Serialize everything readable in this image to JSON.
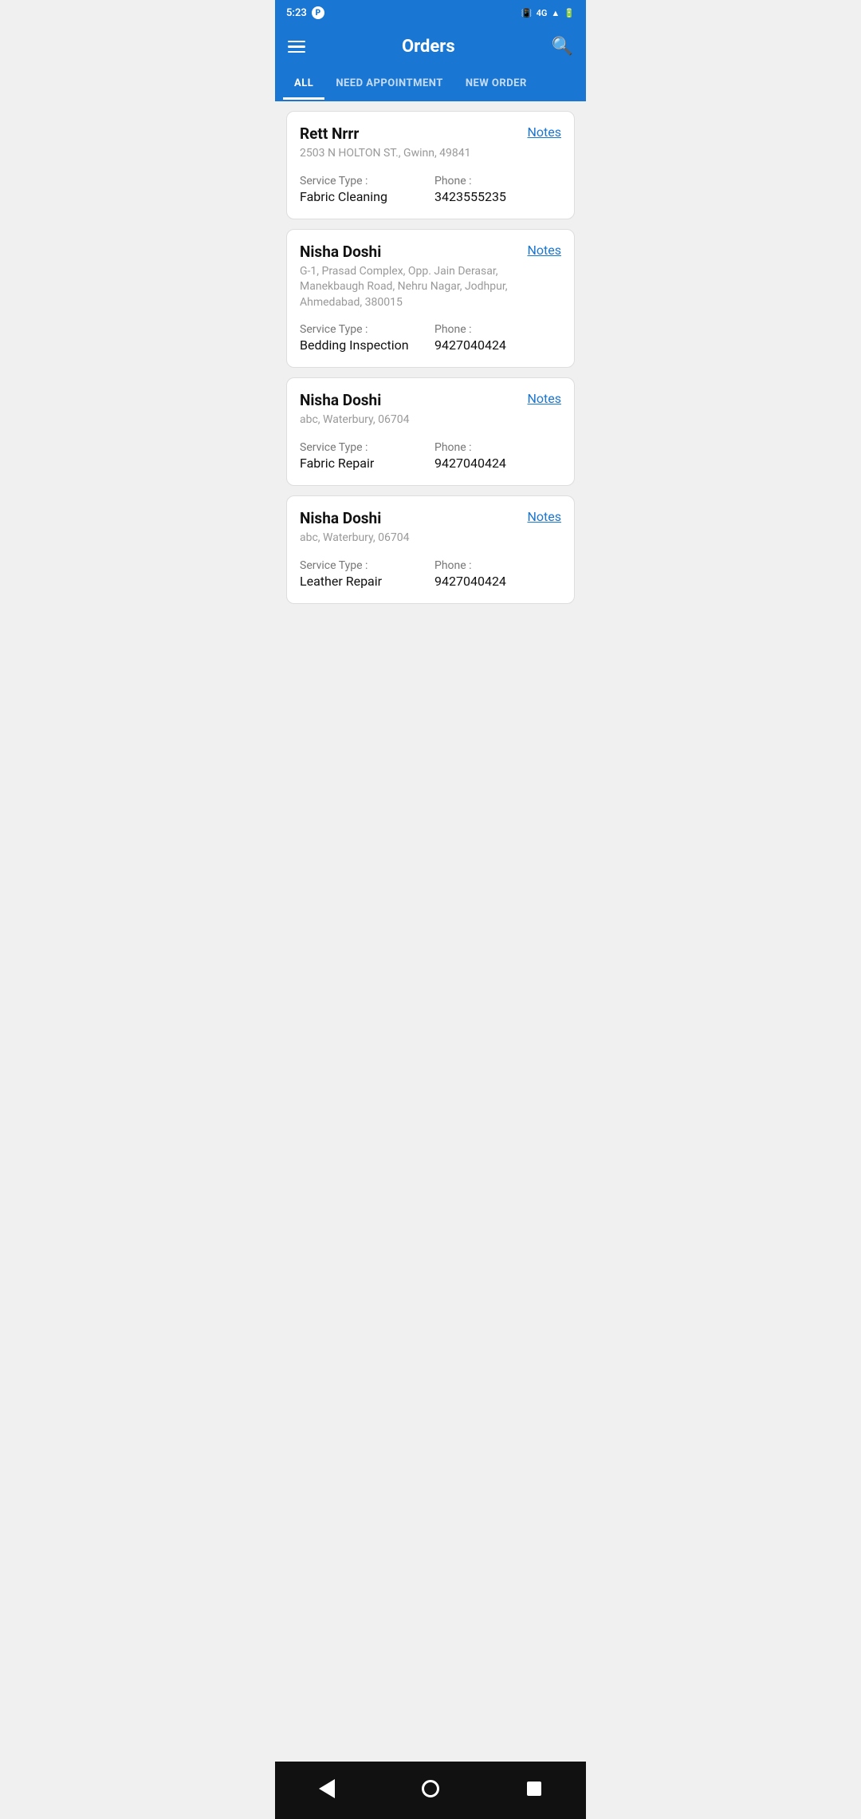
{
  "statusBar": {
    "time": "5:23",
    "signal4g": "4G"
  },
  "header": {
    "title": "Orders",
    "searchLabel": "search"
  },
  "tabs": [
    {
      "id": "all",
      "label": "ALL",
      "active": true
    },
    {
      "id": "need-appointment",
      "label": "NEED APPOINTMENT",
      "active": false
    },
    {
      "id": "new-order",
      "label": "NEW ORDER",
      "active": false
    }
  ],
  "orders": [
    {
      "id": 1,
      "name": "Rett Nrrr",
      "address": "2503 N HOLTON ST., Gwinn, 49841",
      "serviceTypeLabel": "Service Type :",
      "serviceType": "Fabric Cleaning",
      "phoneLabel": "Phone :",
      "phone": "3423555235",
      "notesLabel": "Notes"
    },
    {
      "id": 2,
      "name": "Nisha Doshi",
      "address": "G-1, Prasad Complex, Opp. Jain Derasar, Manekbaugh Road, Nehru Nagar, Jodhpur, Ahmedabad, 380015",
      "serviceTypeLabel": "Service Type :",
      "serviceType": "Bedding Inspection",
      "phoneLabel": "Phone :",
      "phone": "9427040424",
      "notesLabel": "Notes"
    },
    {
      "id": 3,
      "name": "Nisha Doshi",
      "address": "abc, Waterbury, 06704",
      "serviceTypeLabel": "Service Type :",
      "serviceType": "Fabric Repair",
      "phoneLabel": "Phone :",
      "phone": "9427040424",
      "notesLabel": "Notes"
    },
    {
      "id": 4,
      "name": "Nisha Doshi",
      "address": "abc, Waterbury, 06704",
      "serviceTypeLabel": "Service Type :",
      "serviceType": "Leather Repair",
      "phoneLabel": "Phone :",
      "phone": "9427040424",
      "notesLabel": "Notes"
    }
  ],
  "bottomNav": {
    "backLabel": "back",
    "homeLabel": "home",
    "recentLabel": "recent"
  },
  "colors": {
    "primary": "#1976d2",
    "activeTab": "#ffffff",
    "inactiveTab": "rgba(255,255,255,0.75)",
    "cardBg": "#ffffff",
    "notesLink": "#1976d2"
  }
}
